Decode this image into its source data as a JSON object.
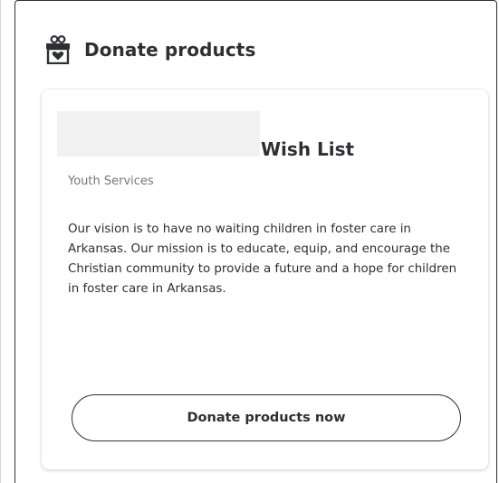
{
  "section": {
    "title": "Donate products",
    "icon": "gift-icon"
  },
  "card": {
    "title": "Wish List",
    "category": "Youth Services",
    "description": "Our vision is to have no waiting children in foster care in Arkansas. Our mission is to educate, equip, and encourage the Christian community to provide a future and a hope for children in foster care in Arkansas.",
    "button_label": "Donate products now"
  },
  "colors": {
    "text": "#2e2f32",
    "muted_text": "#74767c",
    "redaction": "#f1f1f2"
  }
}
